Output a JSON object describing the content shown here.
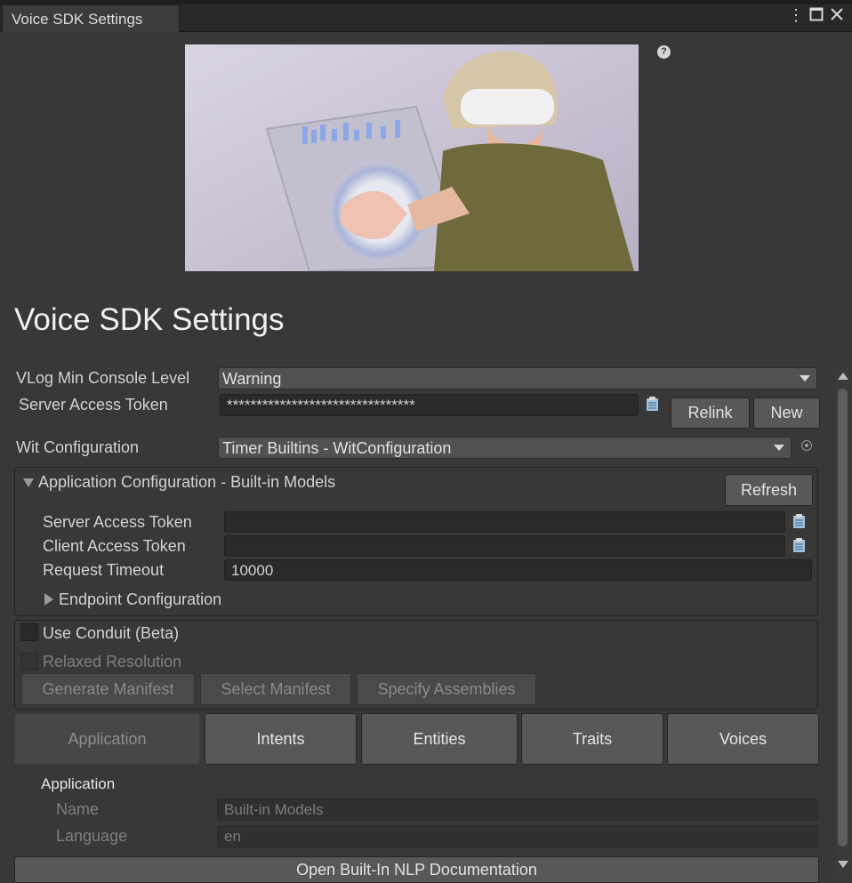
{
  "window": {
    "tab_title": "Voice SDK Settings"
  },
  "page_title": "Voice SDK Settings",
  "vlog": {
    "label": "VLog Min Console Level",
    "value": "Warning"
  },
  "server_token": {
    "label": "Server Access Token",
    "value": "********************************",
    "relink": "Relink",
    "new": "New"
  },
  "wit_config": {
    "label": "Wit Configuration",
    "value": "Timer Builtins - WitConfiguration"
  },
  "app_config": {
    "header": "Application Configuration - Built-in Models",
    "refresh": "Refresh",
    "server_token_label": "Server Access Token",
    "client_token_label": "Client Access Token",
    "timeout_label": "Request Timeout",
    "timeout_value": "10000",
    "endpoint_label": "Endpoint Configuration"
  },
  "conduit": {
    "use_label": "Use Conduit (Beta)",
    "relaxed_label": "Relaxed Resolution",
    "generate": "Generate Manifest",
    "select": "Select Manifest",
    "specify": "Specify Assemblies"
  },
  "tabs": [
    "Application",
    "Intents",
    "Entities",
    "Traits",
    "Voices"
  ],
  "application": {
    "heading": "Application",
    "name_label": "Name",
    "name_value": "Built-in Models",
    "language_label": "Language",
    "language_value": "en"
  },
  "bottom_button": "Open Built-In NLP Documentation",
  "colors": {
    "background": "#383838",
    "button": "#585858",
    "field": "#2a2a2a"
  }
}
